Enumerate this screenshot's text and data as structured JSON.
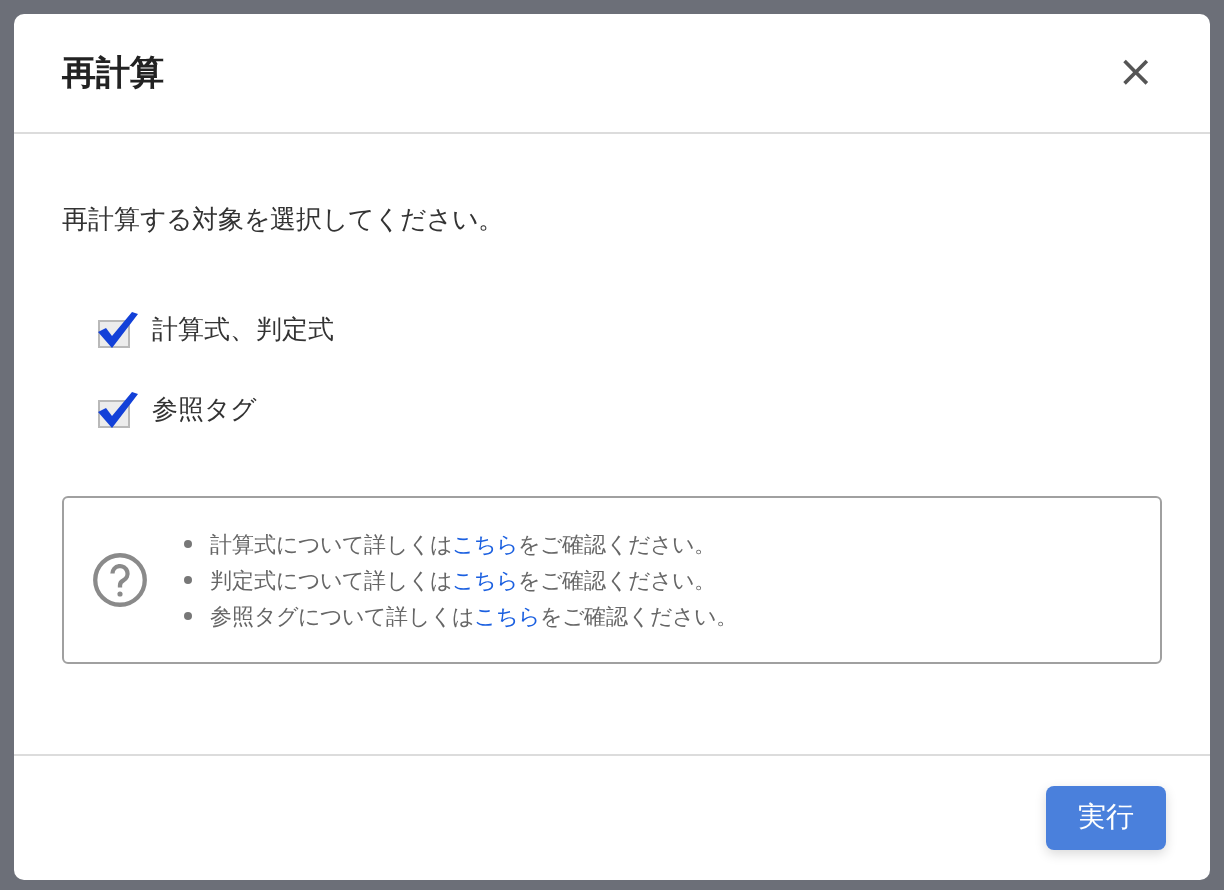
{
  "dialog": {
    "title": "再計算",
    "close_label": "×"
  },
  "instruction": "再計算する対象を選択してください。",
  "options": [
    {
      "label": "計算式、判定式",
      "checked": true
    },
    {
      "label": "参照タグ",
      "checked": true
    }
  ],
  "info": [
    {
      "before": "計算式について詳しくは",
      "link": "こちら",
      "after": "をご確認ください。"
    },
    {
      "before": "判定式について詳しくは",
      "link": "こちら",
      "after": "をご確認ください。"
    },
    {
      "before": "参照タグについて詳しくは",
      "link": "こちら",
      "after": "をご確認ください。"
    }
  ],
  "buttons": [
    {
      "label": "実行"
    }
  ]
}
